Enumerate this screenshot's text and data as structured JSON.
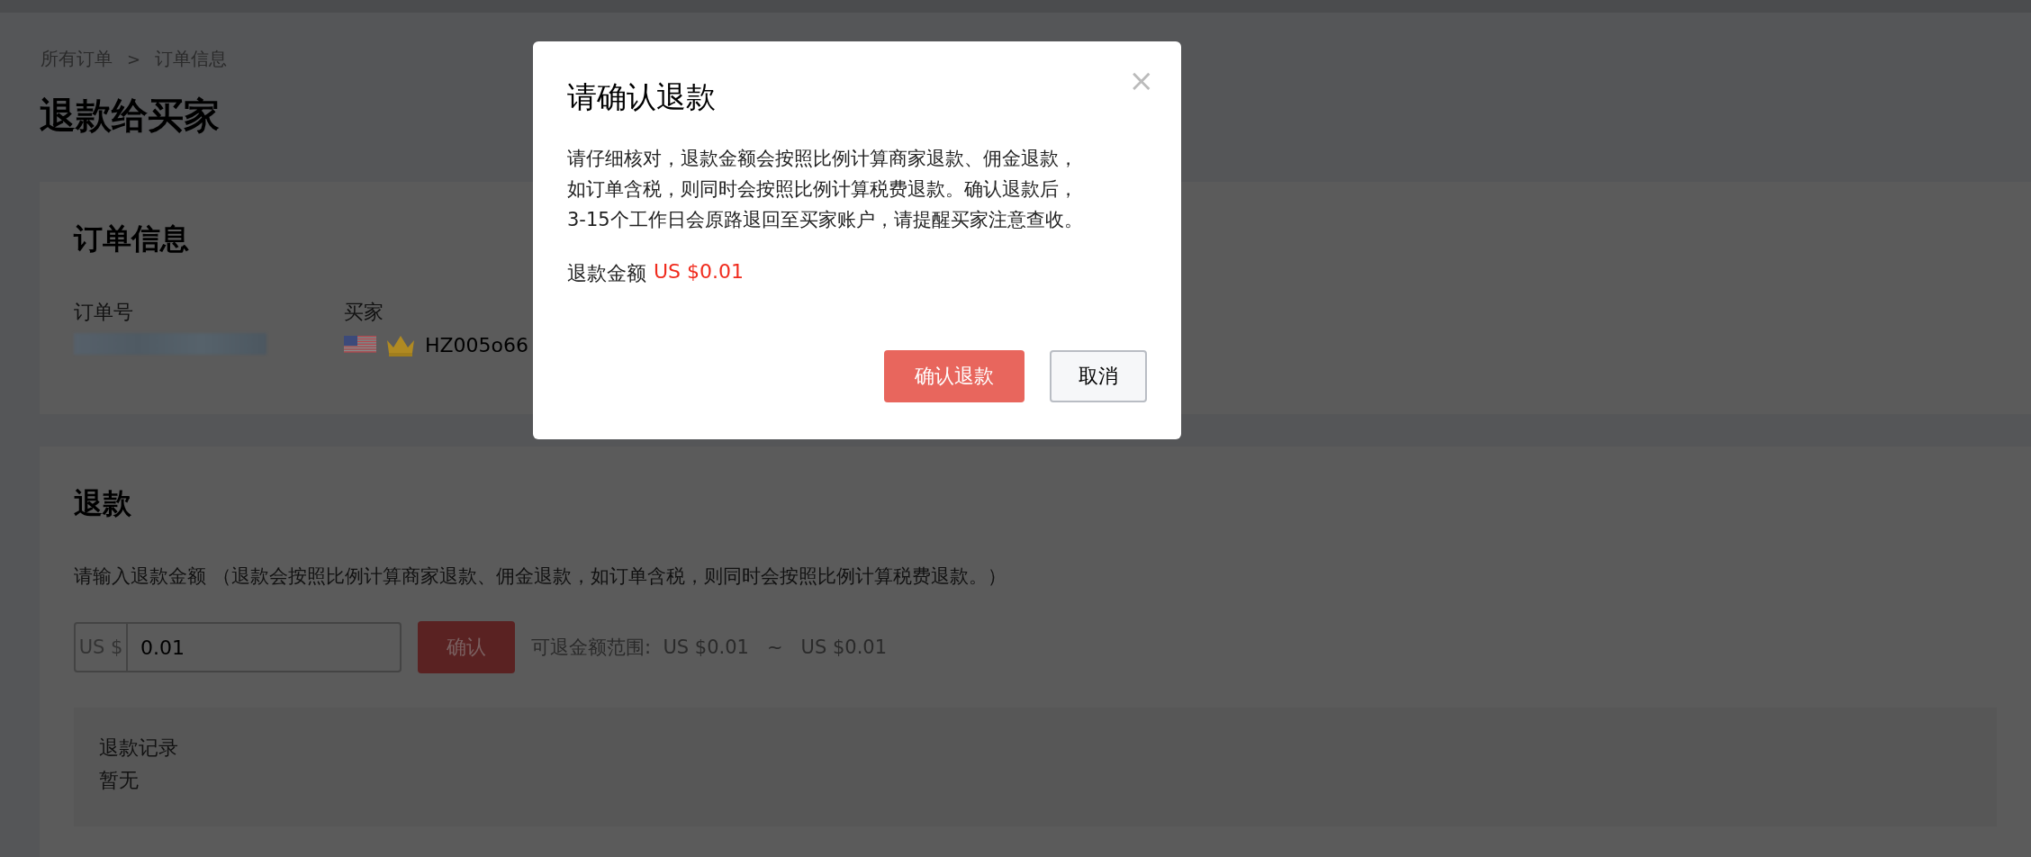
{
  "breadcrumb": [
    "所有订单",
    "订单信息"
  ],
  "breadcrumb_separator": ">",
  "page_title": "退款给买家",
  "order_info": {
    "title": "订单信息",
    "order_number_label": "订单号",
    "buyer_label": "买家",
    "buyer_name": "HZ005o66"
  },
  "refund": {
    "title": "退款",
    "instruction": "请输入退款金额 （退款会按照比例计算商家退款、佣金退款，如订单含税，则同时会按照比例计算税费退款。）",
    "currency_prefix": "US $",
    "amount_value": "0.01",
    "confirm_button": "确认",
    "range_label": "可退金额范围:",
    "range_min": "US $0.01",
    "range_separator": "~",
    "range_max": "US $0.01"
  },
  "records": {
    "title": "退款记录",
    "empty_text": "暂无"
  },
  "dialog": {
    "title": "请确认退款",
    "close": "×",
    "message": "请仔细核对，退款金额会按照比例计算商家退款、佣金退款，如订单含税，则同时会按照比例计算税费退款。确认退款后，3-15个工作日会原路退回至买家账户，请提醒买家注意查收。",
    "amount_label": "退款金额",
    "amount": "US $0.01",
    "buttons": [
      {
        "label": "确认退款",
        "kind": "primary"
      },
      {
        "label": "取消",
        "kind": "secondary"
      }
    ]
  }
}
